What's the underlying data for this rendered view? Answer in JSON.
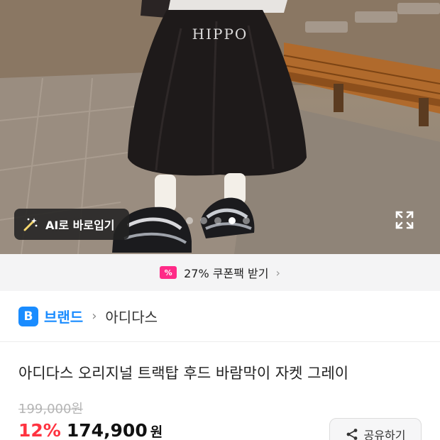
{
  "photo": {
    "watermark": "HIPPO",
    "ai_button_label": "AI로 바로입기",
    "carousel": {
      "count": 5,
      "active_index": 3
    }
  },
  "coupon": {
    "label": "27% 쿠폰팩 받기",
    "icon_text": "%",
    "accent_color": "#ff2a87"
  },
  "breadcrumb": {
    "badge": "B",
    "brand_label": "브랜드",
    "separator": "›",
    "brand_name": "아디다스",
    "accent_color": "#1a8cff"
  },
  "product": {
    "title": "아디다스 오리지널 트랙탑 후드 바람막이 자켓 그레이",
    "original_price": "199,000원",
    "discount": "12%",
    "price": "174,900",
    "currency": "원",
    "discount_color": "#ff3340"
  },
  "actions": {
    "share_label": "공유하기"
  }
}
